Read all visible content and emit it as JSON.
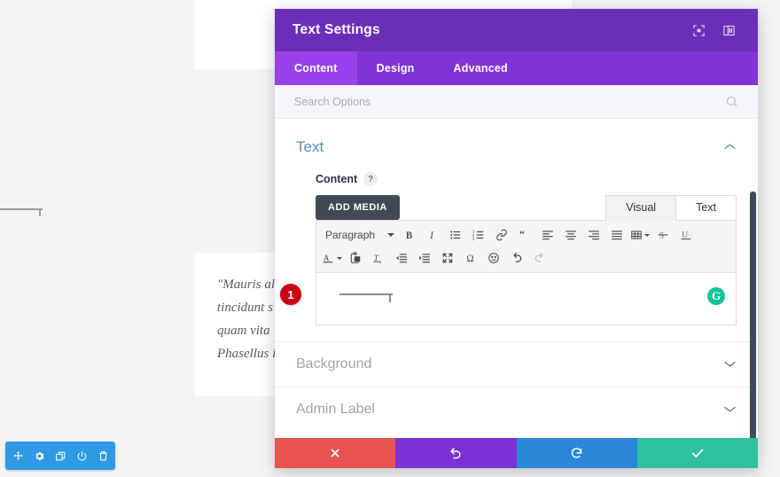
{
  "background": {
    "quote": "\"Mauris al\ntincidunt s\nquam vita\nPhasellus i",
    "hr_name": "horizontal-rule"
  },
  "module_actions": {
    "items": [
      {
        "icon": "move-icon",
        "name": "move-module-button"
      },
      {
        "icon": "gear-icon",
        "name": "module-settings-button"
      },
      {
        "icon": "duplicate-icon",
        "name": "duplicate-module-button"
      },
      {
        "icon": "power-icon",
        "name": "disable-module-button"
      },
      {
        "icon": "trash-icon",
        "name": "delete-module-button"
      }
    ]
  },
  "modal": {
    "title": "Text Settings",
    "header_icons": [
      {
        "icon": "fullscreen-icon",
        "name": "expand-modal-button"
      },
      {
        "icon": "panel-layout-icon",
        "name": "modal-layout-button"
      }
    ],
    "tabs": [
      {
        "label": "Content",
        "active": true
      },
      {
        "label": "Design",
        "active": false
      },
      {
        "label": "Advanced",
        "active": false
      }
    ],
    "search": {
      "placeholder": "Search Options",
      "value": "",
      "icon": "search-icon"
    },
    "section": {
      "title": "Text",
      "toggle_icon": "chevron-up-icon",
      "field_label": "Content",
      "help_icon": "?"
    },
    "editor": {
      "add_media_label": "ADD MEDIA",
      "mode_tabs": [
        {
          "label": "Visual",
          "active": true
        },
        {
          "label": "Text",
          "active": false
        }
      ],
      "format_select": "Paragraph",
      "toolbar_row1": [
        {
          "icon": "format-select",
          "name": "paragraph-format-select"
        },
        {
          "icon": "bold-icon",
          "name": "bold-button"
        },
        {
          "icon": "italic-icon",
          "name": "italic-button"
        },
        {
          "icon": "bullet-list-icon",
          "name": "bullet-list-button"
        },
        {
          "icon": "numbered-list-icon",
          "name": "numbered-list-button"
        },
        {
          "icon": "link-icon",
          "name": "insert-link-button"
        },
        {
          "icon": "blockquote-icon",
          "name": "blockquote-button"
        },
        {
          "icon": "align-left-icon",
          "name": "align-left-button"
        },
        {
          "icon": "align-center-icon",
          "name": "align-center-button"
        },
        {
          "icon": "align-right-icon",
          "name": "align-right-button"
        },
        {
          "icon": "align-justify-icon",
          "name": "align-justify-button"
        },
        {
          "icon": "table-icon",
          "name": "insert-table-button"
        },
        {
          "icon": "strikethrough-icon",
          "name": "strikethrough-button"
        },
        {
          "icon": "underline-icon",
          "name": "underline-button"
        }
      ],
      "toolbar_row2": [
        {
          "icon": "text-color-icon",
          "name": "text-color-button"
        },
        {
          "icon": "paste-as-text-icon",
          "name": "paste-as-text-button"
        },
        {
          "icon": "clear-formatting-icon",
          "name": "clear-formatting-button"
        },
        {
          "icon": "outdent-icon",
          "name": "outdent-button"
        },
        {
          "icon": "indent-icon",
          "name": "indent-button"
        },
        {
          "icon": "fullscreen-icon",
          "name": "distraction-free-button"
        },
        {
          "icon": "omega-icon",
          "name": "special-character-button"
        },
        {
          "icon": "emoji-icon",
          "name": "emoji-button"
        },
        {
          "icon": "undo-icon",
          "name": "editor-undo-button"
        },
        {
          "icon": "redo-icon",
          "name": "editor-redo-button"
        }
      ],
      "content_value": "",
      "content_hr_name": "horizontal-rule-block",
      "grammarly": {
        "label": "G",
        "name": "grammarly-icon"
      }
    },
    "collapsed_sections": [
      {
        "label": "Background",
        "icon": "chevron-down-icon"
      },
      {
        "label": "Admin Label",
        "icon": "chevron-down-icon"
      }
    ],
    "footer": [
      {
        "icon": "close-icon",
        "name": "discard-changes-button",
        "color": "#e8544e"
      },
      {
        "icon": "undo-icon",
        "name": "undo-button",
        "color": "#7b32d4"
      },
      {
        "icon": "redo-icon",
        "name": "redo-button",
        "color": "#2b87d8"
      },
      {
        "icon": "check-icon",
        "name": "save-changes-button",
        "color": "#2fc0a0"
      }
    ]
  },
  "annotations": {
    "badge_1": "1"
  },
  "colors": {
    "header_purple": "#6c2eb9",
    "tab_purple": "#8134d6",
    "active_tab_purple": "#9742e8",
    "action_bar_blue": "#2e9ae5",
    "badge_red": "#c90016",
    "grammarly_green": "#15c39a"
  }
}
